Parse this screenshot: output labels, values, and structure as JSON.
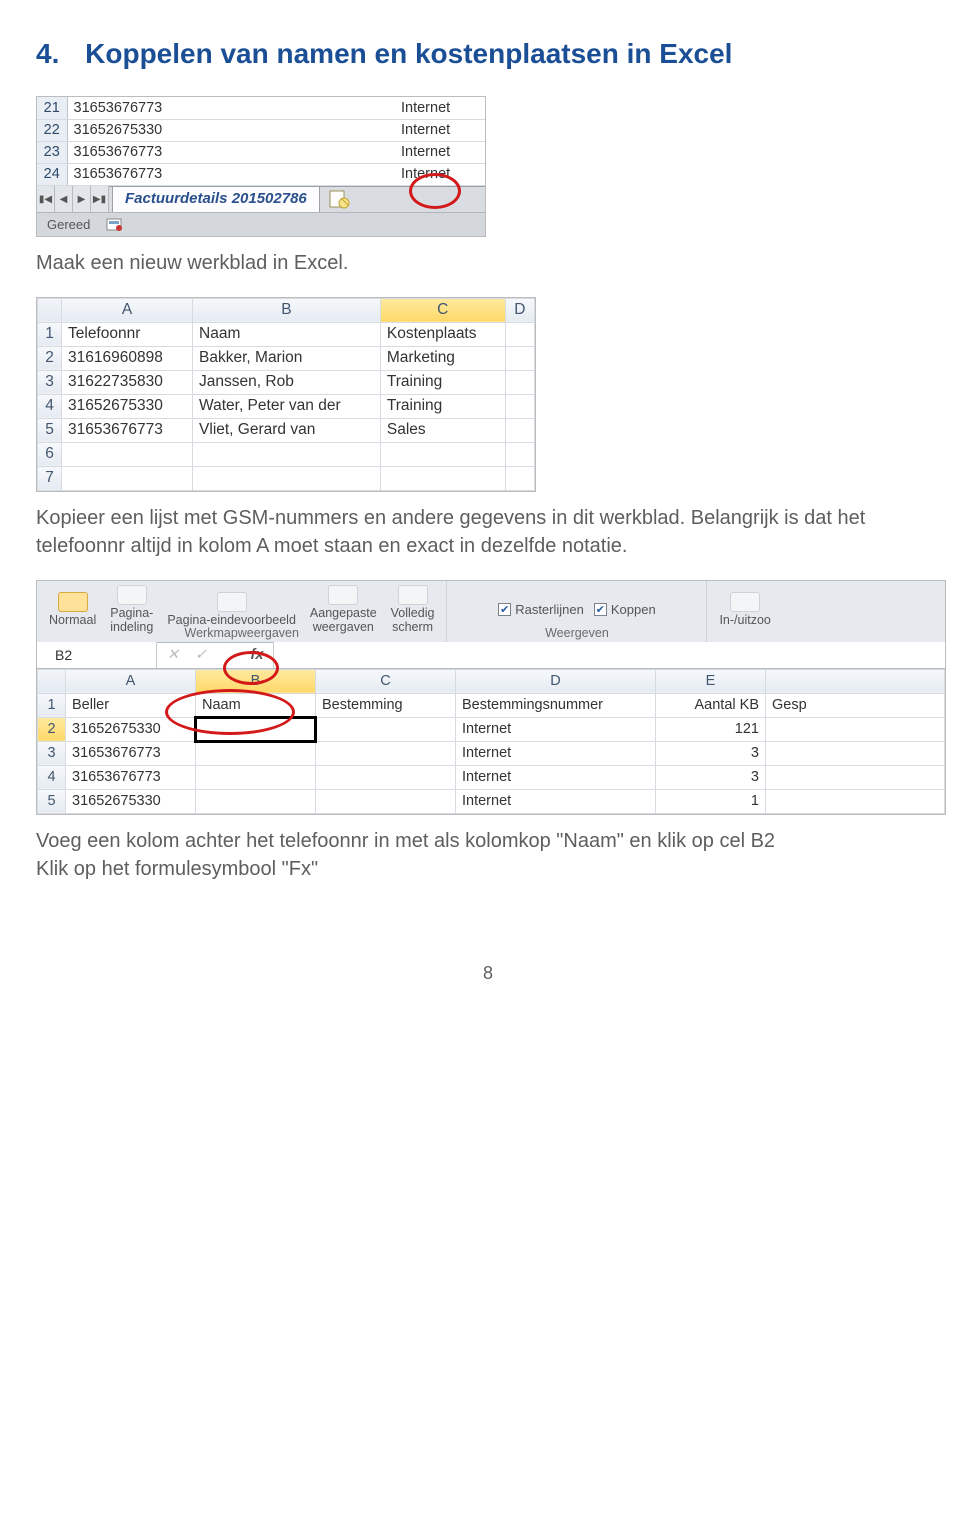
{
  "heading": {
    "number": "4.",
    "title": "Koppelen van namen en kostenplaatsen in Excel"
  },
  "fig1": {
    "rows": [
      {
        "n": "21",
        "a": "31653676773",
        "c": "Internet"
      },
      {
        "n": "22",
        "a": "31652675330",
        "c": "Internet"
      },
      {
        "n": "23",
        "a": "31653676773",
        "c": "Internet"
      },
      {
        "n": "24",
        "a": "31653676773",
        "c": "Internet"
      }
    ],
    "sheet_tab": "Factuurdetails 201502786",
    "status": "Gereed"
  },
  "para1": "Maak een nieuw werkblad in Excel.",
  "fig2": {
    "cols": [
      "A",
      "B",
      "C",
      "D"
    ],
    "rows": [
      {
        "n": "1",
        "a": "Telefoonnr",
        "b": "Naam",
        "c": "Kostenplaats",
        "d": ""
      },
      {
        "n": "2",
        "a": "31616960898",
        "b": "Bakker, Marion",
        "c": "Marketing",
        "d": ""
      },
      {
        "n": "3",
        "a": "31622735830",
        "b": "Janssen, Rob",
        "c": "Training",
        "d": ""
      },
      {
        "n": "4",
        "a": "31652675330",
        "b": "Water, Peter van der",
        "c": "Training",
        "d": ""
      },
      {
        "n": "5",
        "a": "31653676773",
        "b": "Vliet, Gerard van",
        "c": "Sales",
        "d": ""
      },
      {
        "n": "6",
        "a": "",
        "b": "",
        "c": "",
        "d": ""
      },
      {
        "n": "7",
        "a": "",
        "b": "",
        "c": "",
        "d": ""
      }
    ]
  },
  "para2": "Kopieer een lijst met GSM-nummers en andere gegevens in dit werkblad. Belangrijk is dat het telefoonnr altijd in kolom A moet staan en exact in dezelfde notatie.",
  "fig3": {
    "ribbon": {
      "btn_normaal": "Normaal",
      "btn_pagina": "Pagina-\nindeling",
      "btn_eind": "Pagina-eindevoorbeeld",
      "btn_aangepast": "Aangepaste\nweergaven",
      "btn_volledig": "Volledig\nscherm",
      "group1_caption": "Werkmapweergaven",
      "chk_raster": "Rasterlijnen",
      "chk_koppen": "Koppen",
      "group2_caption": "Weergeven",
      "btn_zoom": "In-/uitzoo"
    },
    "namebox": "B2",
    "fx_label": "fx",
    "cols": [
      "A",
      "B",
      "C",
      "D",
      "E",
      ""
    ],
    "rows": [
      {
        "n": "1",
        "a": "Beller",
        "b": "Naam",
        "c": "Bestemming",
        "d": "Bestemmingsnummer",
        "e": "Aantal KB",
        "f": "Gesp"
      },
      {
        "n": "2",
        "a": "31652675330",
        "b": "",
        "c": "",
        "d": "Internet",
        "e": "121",
        "f": ""
      },
      {
        "n": "3",
        "a": "31653676773",
        "b": "",
        "c": "",
        "d": "Internet",
        "e": "3",
        "f": ""
      },
      {
        "n": "4",
        "a": "31653676773",
        "b": "",
        "c": "",
        "d": "Internet",
        "e": "3",
        "f": ""
      },
      {
        "n": "5",
        "a": "31652675330",
        "b": "",
        "c": "",
        "d": "Internet",
        "e": "1",
        "f": ""
      }
    ]
  },
  "para3a": "Voeg een kolom achter het telefoonnr in met als kolomkop \"Naam\" en klik op cel B2",
  "para3b": "Klik op het formulesymbool \"Fx\"",
  "page_number": "8"
}
